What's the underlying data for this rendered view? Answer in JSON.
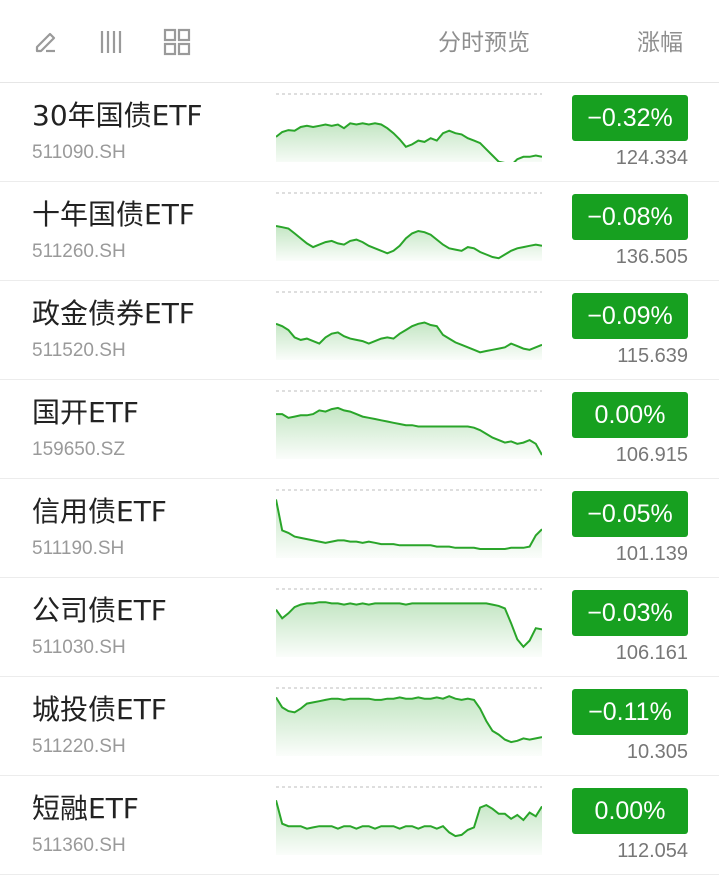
{
  "header": {
    "icons": [
      "edit-icon",
      "columns-icon",
      "grid-icon"
    ],
    "preview_label": "分时预览",
    "change_label": "涨幅"
  },
  "colors": {
    "accent_green": "#17a020",
    "spark_line": "#2aa52a"
  },
  "rows": [
    {
      "name": "30年国债ETF",
      "code": "511090.SH",
      "change": "−0.32%",
      "price": "124.334",
      "spark": [
        0.66,
        0.58,
        0.55,
        0.56,
        0.5,
        0.48,
        0.5,
        0.48,
        0.46,
        0.48,
        0.46,
        0.52,
        0.44,
        0.46,
        0.44,
        0.46,
        0.44,
        0.46,
        0.52,
        0.6,
        0.7,
        0.82,
        0.78,
        0.72,
        0.74,
        0.68,
        0.72,
        0.6,
        0.56,
        0.6,
        0.62,
        0.68,
        0.72,
        0.76,
        0.86,
        0.96,
        1.06,
        1.08,
        1.12,
        1.02,
        0.98,
        0.98,
        0.96,
        0.98
      ]
    },
    {
      "name": "十年国债ETF",
      "code": "511260.SH",
      "change": "−0.08%",
      "price": "136.505",
      "spark": [
        0.5,
        0.52,
        0.54,
        0.62,
        0.7,
        0.78,
        0.84,
        0.8,
        0.76,
        0.74,
        0.78,
        0.8,
        0.74,
        0.72,
        0.76,
        0.82,
        0.86,
        0.9,
        0.94,
        0.9,
        0.82,
        0.7,
        0.62,
        0.58,
        0.6,
        0.64,
        0.72,
        0.8,
        0.86,
        0.88,
        0.9,
        0.84,
        0.86,
        0.92,
        0.96,
        1.0,
        1.02,
        0.96,
        0.9,
        0.86,
        0.84,
        0.82,
        0.8,
        0.82
      ]
    },
    {
      "name": "政金债券ETF",
      "code": "511520.SH",
      "change": "−0.09%",
      "price": "115.639",
      "spark": [
        0.48,
        0.52,
        0.58,
        0.7,
        0.74,
        0.72,
        0.76,
        0.8,
        0.7,
        0.64,
        0.62,
        0.68,
        0.72,
        0.74,
        0.76,
        0.8,
        0.76,
        0.72,
        0.7,
        0.72,
        0.64,
        0.58,
        0.52,
        0.48,
        0.46,
        0.5,
        0.52,
        0.66,
        0.72,
        0.78,
        0.82,
        0.86,
        0.9,
        0.94,
        0.92,
        0.9,
        0.88,
        0.86,
        0.8,
        0.84,
        0.88,
        0.9,
        0.86,
        0.82
      ]
    },
    {
      "name": "国开ETF",
      "code": "159650.SZ",
      "change": "0.00%",
      "price": "106.915",
      "spark": [
        0.34,
        0.34,
        0.4,
        0.38,
        0.36,
        0.36,
        0.34,
        0.28,
        0.3,
        0.26,
        0.24,
        0.28,
        0.3,
        0.34,
        0.38,
        0.4,
        0.42,
        0.44,
        0.46,
        0.48,
        0.5,
        0.52,
        0.52,
        0.54,
        0.54,
        0.54,
        0.54,
        0.54,
        0.54,
        0.54,
        0.54,
        0.54,
        0.56,
        0.6,
        0.66,
        0.72,
        0.76,
        0.8,
        0.78,
        0.82,
        0.8,
        0.76,
        0.82,
        1.0
      ]
    },
    {
      "name": "信用债ETF",
      "code": "511190.SH",
      "change": "−0.05%",
      "price": "101.139",
      "spark": [
        0.12,
        0.62,
        0.66,
        0.72,
        0.74,
        0.76,
        0.78,
        0.8,
        0.82,
        0.8,
        0.78,
        0.78,
        0.8,
        0.8,
        0.82,
        0.8,
        0.82,
        0.84,
        0.84,
        0.84,
        0.86,
        0.86,
        0.86,
        0.86,
        0.86,
        0.86,
        0.88,
        0.88,
        0.88,
        0.9,
        0.9,
        0.9,
        0.9,
        0.92,
        0.92,
        0.92,
        0.92,
        0.92,
        0.9,
        0.9,
        0.9,
        0.88,
        0.7,
        0.6
      ]
    },
    {
      "name": "公司债ETF",
      "code": "511030.SH",
      "change": "−0.03%",
      "price": "106.161",
      "spark": [
        0.3,
        0.44,
        0.36,
        0.26,
        0.22,
        0.2,
        0.2,
        0.18,
        0.18,
        0.2,
        0.2,
        0.22,
        0.2,
        0.22,
        0.2,
        0.22,
        0.2,
        0.2,
        0.2,
        0.2,
        0.2,
        0.22,
        0.2,
        0.2,
        0.2,
        0.2,
        0.2,
        0.2,
        0.2,
        0.2,
        0.2,
        0.2,
        0.2,
        0.2,
        0.2,
        0.22,
        0.24,
        0.28,
        0.52,
        0.78,
        0.9,
        0.8,
        0.6,
        0.62
      ]
    },
    {
      "name": "城投债ETF",
      "code": "511220.SH",
      "change": "−0.11%",
      "price": "10.305",
      "spark": [
        0.12,
        0.28,
        0.34,
        0.36,
        0.3,
        0.22,
        0.2,
        0.18,
        0.16,
        0.14,
        0.14,
        0.16,
        0.14,
        0.14,
        0.14,
        0.14,
        0.16,
        0.16,
        0.14,
        0.14,
        0.12,
        0.14,
        0.14,
        0.12,
        0.14,
        0.14,
        0.12,
        0.14,
        0.1,
        0.14,
        0.16,
        0.14,
        0.16,
        0.3,
        0.5,
        0.66,
        0.72,
        0.8,
        0.84,
        0.82,
        0.78,
        0.8,
        0.78,
        0.76
      ]
    },
    {
      "name": "短融ETF",
      "code": "511360.SH",
      "change": "0.00%",
      "price": "112.054",
      "spark": [
        0.18,
        0.56,
        0.6,
        0.6,
        0.6,
        0.64,
        0.62,
        0.6,
        0.6,
        0.6,
        0.64,
        0.6,
        0.6,
        0.64,
        0.6,
        0.6,
        0.64,
        0.6,
        0.6,
        0.6,
        0.64,
        0.6,
        0.6,
        0.64,
        0.6,
        0.6,
        0.64,
        0.6,
        0.7,
        0.76,
        0.74,
        0.66,
        0.62,
        0.3,
        0.26,
        0.32,
        0.4,
        0.4,
        0.48,
        0.42,
        0.5,
        0.38,
        0.44,
        0.28
      ]
    }
  ]
}
